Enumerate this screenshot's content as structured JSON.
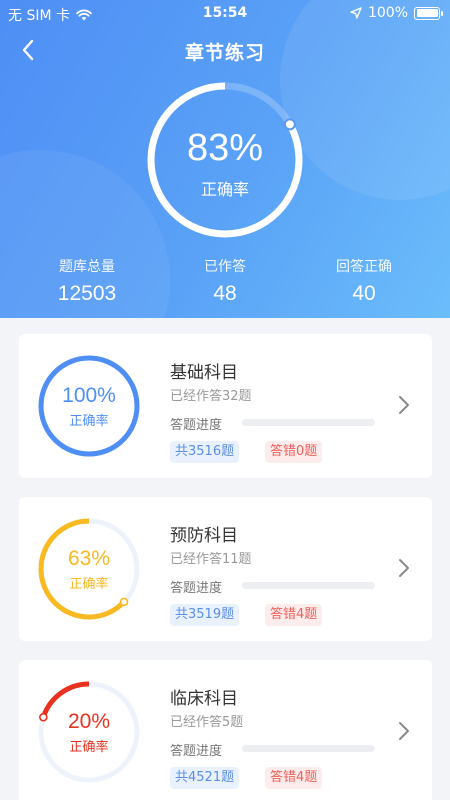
{
  "status_bar": {
    "carrier": "无 SIM 卡",
    "time": "15:54",
    "battery": "100%"
  },
  "nav": {
    "title": "章节练习"
  },
  "summary": {
    "accuracy_text": "83%",
    "accuracy_value": 0.83,
    "accuracy_label": "正确率",
    "stats": [
      {
        "label": "题库总量",
        "value": "12503"
      },
      {
        "label": "已作答",
        "value": "48"
      },
      {
        "label": "回答正确",
        "value": "40"
      }
    ]
  },
  "subjects": [
    {
      "title": "基础科目",
      "answered": "已经作答32题",
      "accuracy_text": "100%",
      "accuracy_value": 1.0,
      "accuracy_label": "正确率",
      "color": "#4e8ef5",
      "progress_label": "答题进度",
      "progress_value": 0.0,
      "total": "共3516题",
      "wrong": "答错0题"
    },
    {
      "title": "预防科目",
      "answered": "已经作答11题",
      "accuracy_text": "63%",
      "accuracy_value": 0.63,
      "accuracy_label": "正确率",
      "color": "#f8b921",
      "progress_label": "答题进度",
      "progress_value": 0.0,
      "total": "共3519题",
      "wrong": "答错4题"
    },
    {
      "title": "临床科目",
      "answered": "已经作答5题",
      "accuracy_text": "20%",
      "accuracy_value": 0.2,
      "accuracy_label": "正确率",
      "color": "#e8321f",
      "progress_label": "答题进度",
      "progress_value": 0.0,
      "total": "共4521题",
      "wrong": "答错4题"
    }
  ]
}
